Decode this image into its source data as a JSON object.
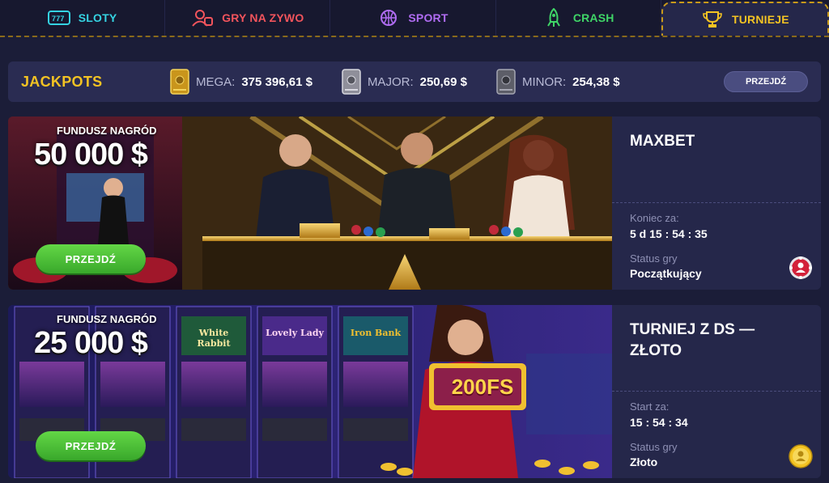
{
  "nav": {
    "tabs": [
      {
        "label": "SLOTY",
        "icon": "slot-machine-icon"
      },
      {
        "label": "GRY NA ZYWO",
        "icon": "live-dealer-icon"
      },
      {
        "label": "SPORT",
        "icon": "basketball-icon"
      },
      {
        "label": "CRASH",
        "icon": "rocket-icon"
      },
      {
        "label": "TURNIEJE",
        "icon": "trophy-icon"
      }
    ],
    "active": "TURNIEJE"
  },
  "jackpots": {
    "title": "JACKPOTS",
    "items": [
      {
        "label": "MEGA:",
        "value": "375 396,61 $",
        "icon": "gold-safe-icon"
      },
      {
        "label": "MAJOR:",
        "value": "250,69 $",
        "icon": "silver-safe-icon"
      },
      {
        "label": "MINOR:",
        "value": "254,38 $",
        "icon": "grey-safe-icon"
      }
    ],
    "button": "PRZEJDŹ"
  },
  "tournaments": [
    {
      "prize_label": "FUNDUSZ NAGRÓD",
      "prize_amount": "50 000 $",
      "button": "PRZEJDŹ",
      "name": "MAXBET",
      "time_label": "Koniec za:",
      "time_value": "5 d 15 : 54 : 35",
      "status_label": "Status gry",
      "status_value": "Początkujący",
      "badge_icon": "casino-chip-icon"
    },
    {
      "prize_label": "FUNDUSZ NAGRÓD",
      "prize_amount": "25 000 $",
      "button": "PRZEJDŹ",
      "name": "TURNIEJ Z DS — ZŁOTO",
      "time_label": "Start za:",
      "time_value": "15 : 54 : 34",
      "status_label": "Status gry",
      "status_value": "Złoto",
      "badge_icon": "gold-medal-icon",
      "banner_sign": "200FS",
      "slot_titles": [
        "White Rabbit",
        "Lovely Lady",
        "Iron Bank"
      ]
    }
  ],
  "colors": {
    "background": "#1b1d38",
    "accent_gold": "#f3c323",
    "button_green": "#4cc437"
  }
}
